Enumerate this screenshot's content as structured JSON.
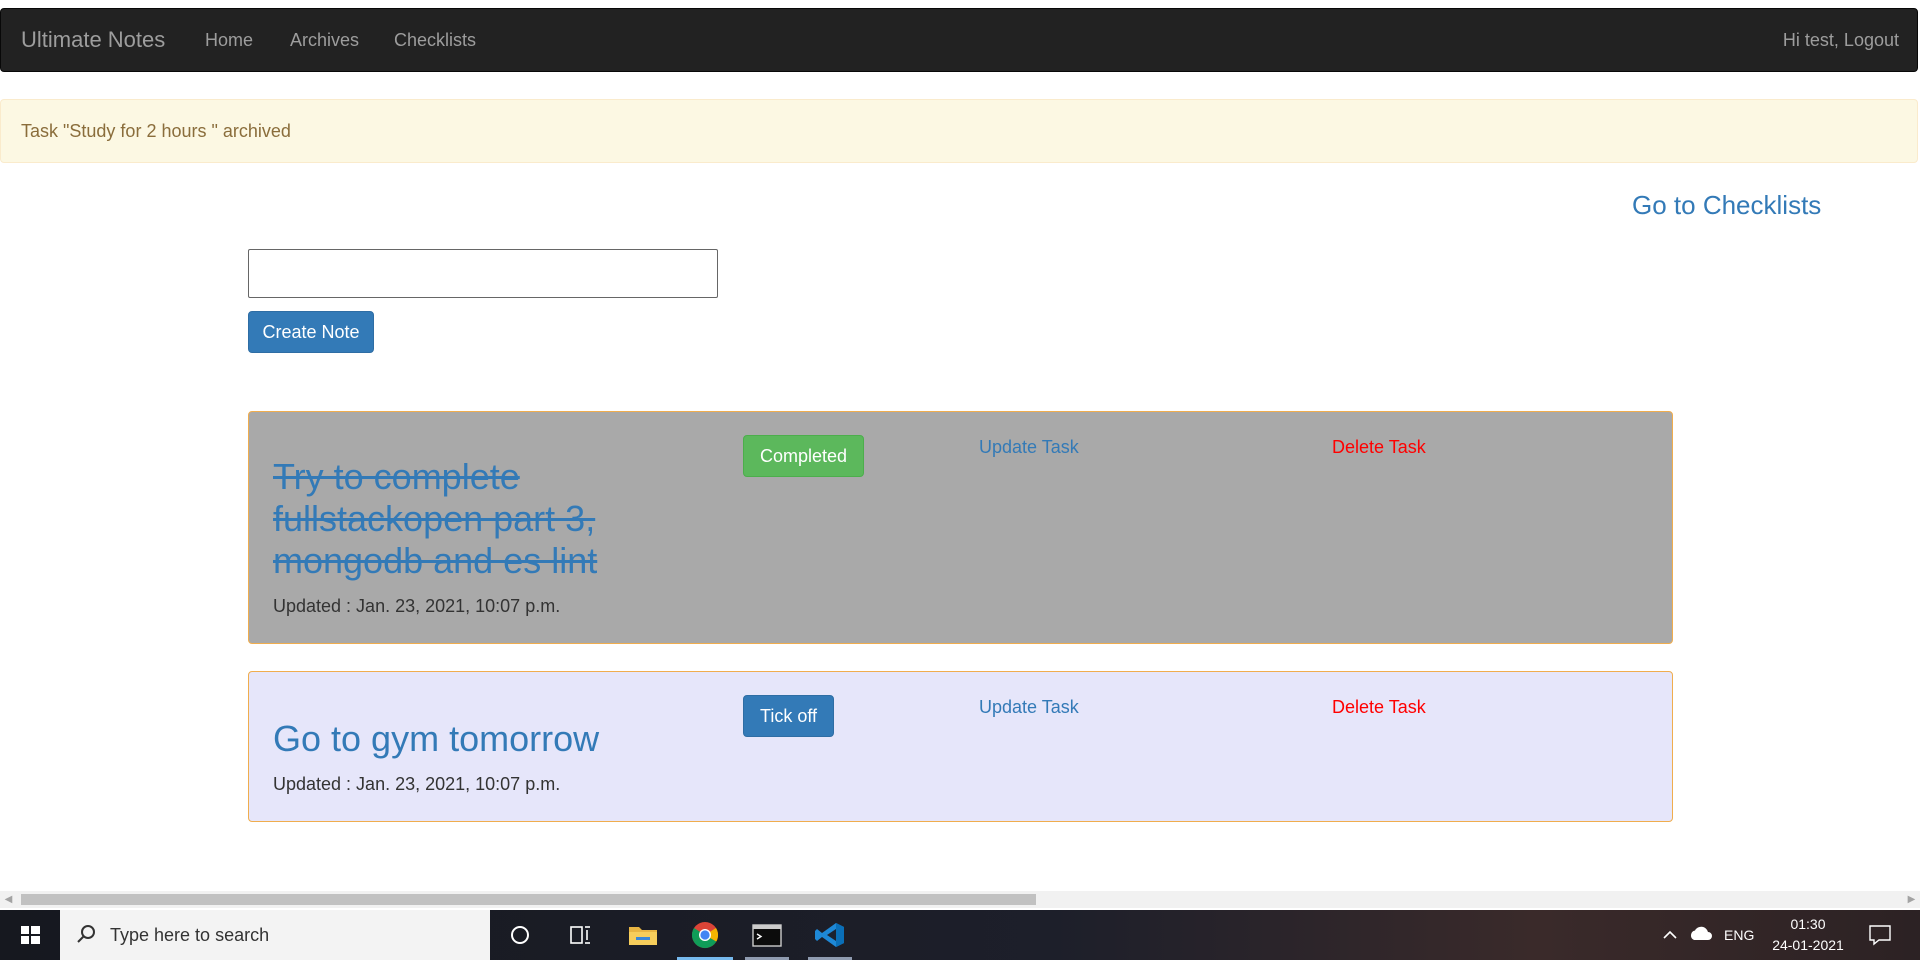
{
  "navbar": {
    "brand": "Ultimate Notes",
    "links": [
      "Home",
      "Archives",
      "Checklists"
    ],
    "user_text": "Hi test, Logout"
  },
  "alert": {
    "message": "Task \"Study for 2 hours \" archived"
  },
  "go_checklists": "Go to Checklists",
  "note_form": {
    "input_value": "",
    "create_label": "Create Note"
  },
  "tasks": [
    {
      "title": "Try to complete fullstackopen part 3, mongodb and es lint",
      "updated": "Updated : Jan. 23, 2021, 10:07 p.m.",
      "status_label": "Completed",
      "update_label": "Update Task",
      "delete_label": "Delete Task",
      "completed": true
    },
    {
      "title": "Go to gym tomorrow",
      "updated": "Updated : Jan. 23, 2021, 10:07 p.m.",
      "status_label": "Tick off",
      "update_label": "Update Task",
      "delete_label": "Delete Task",
      "completed": false
    }
  ],
  "colors": {
    "link": "#337ab7",
    "completed_bg": "#a9a9a9",
    "todo_bg": "#e6e6fa",
    "card_border": "#f0ad4e",
    "delete": "#ff0000",
    "success": "#5cb85c"
  },
  "taskbar": {
    "search_placeholder": "Type here to search",
    "icons": [
      "windows-start-icon",
      "search-icon",
      "cortana-icon",
      "task-view-icon",
      "file-explorer-icon",
      "chrome-icon",
      "terminal-icon",
      "vscode-icon"
    ],
    "tray": {
      "language": "ENG",
      "time": "01:30",
      "date": "24-01-2021"
    }
  }
}
